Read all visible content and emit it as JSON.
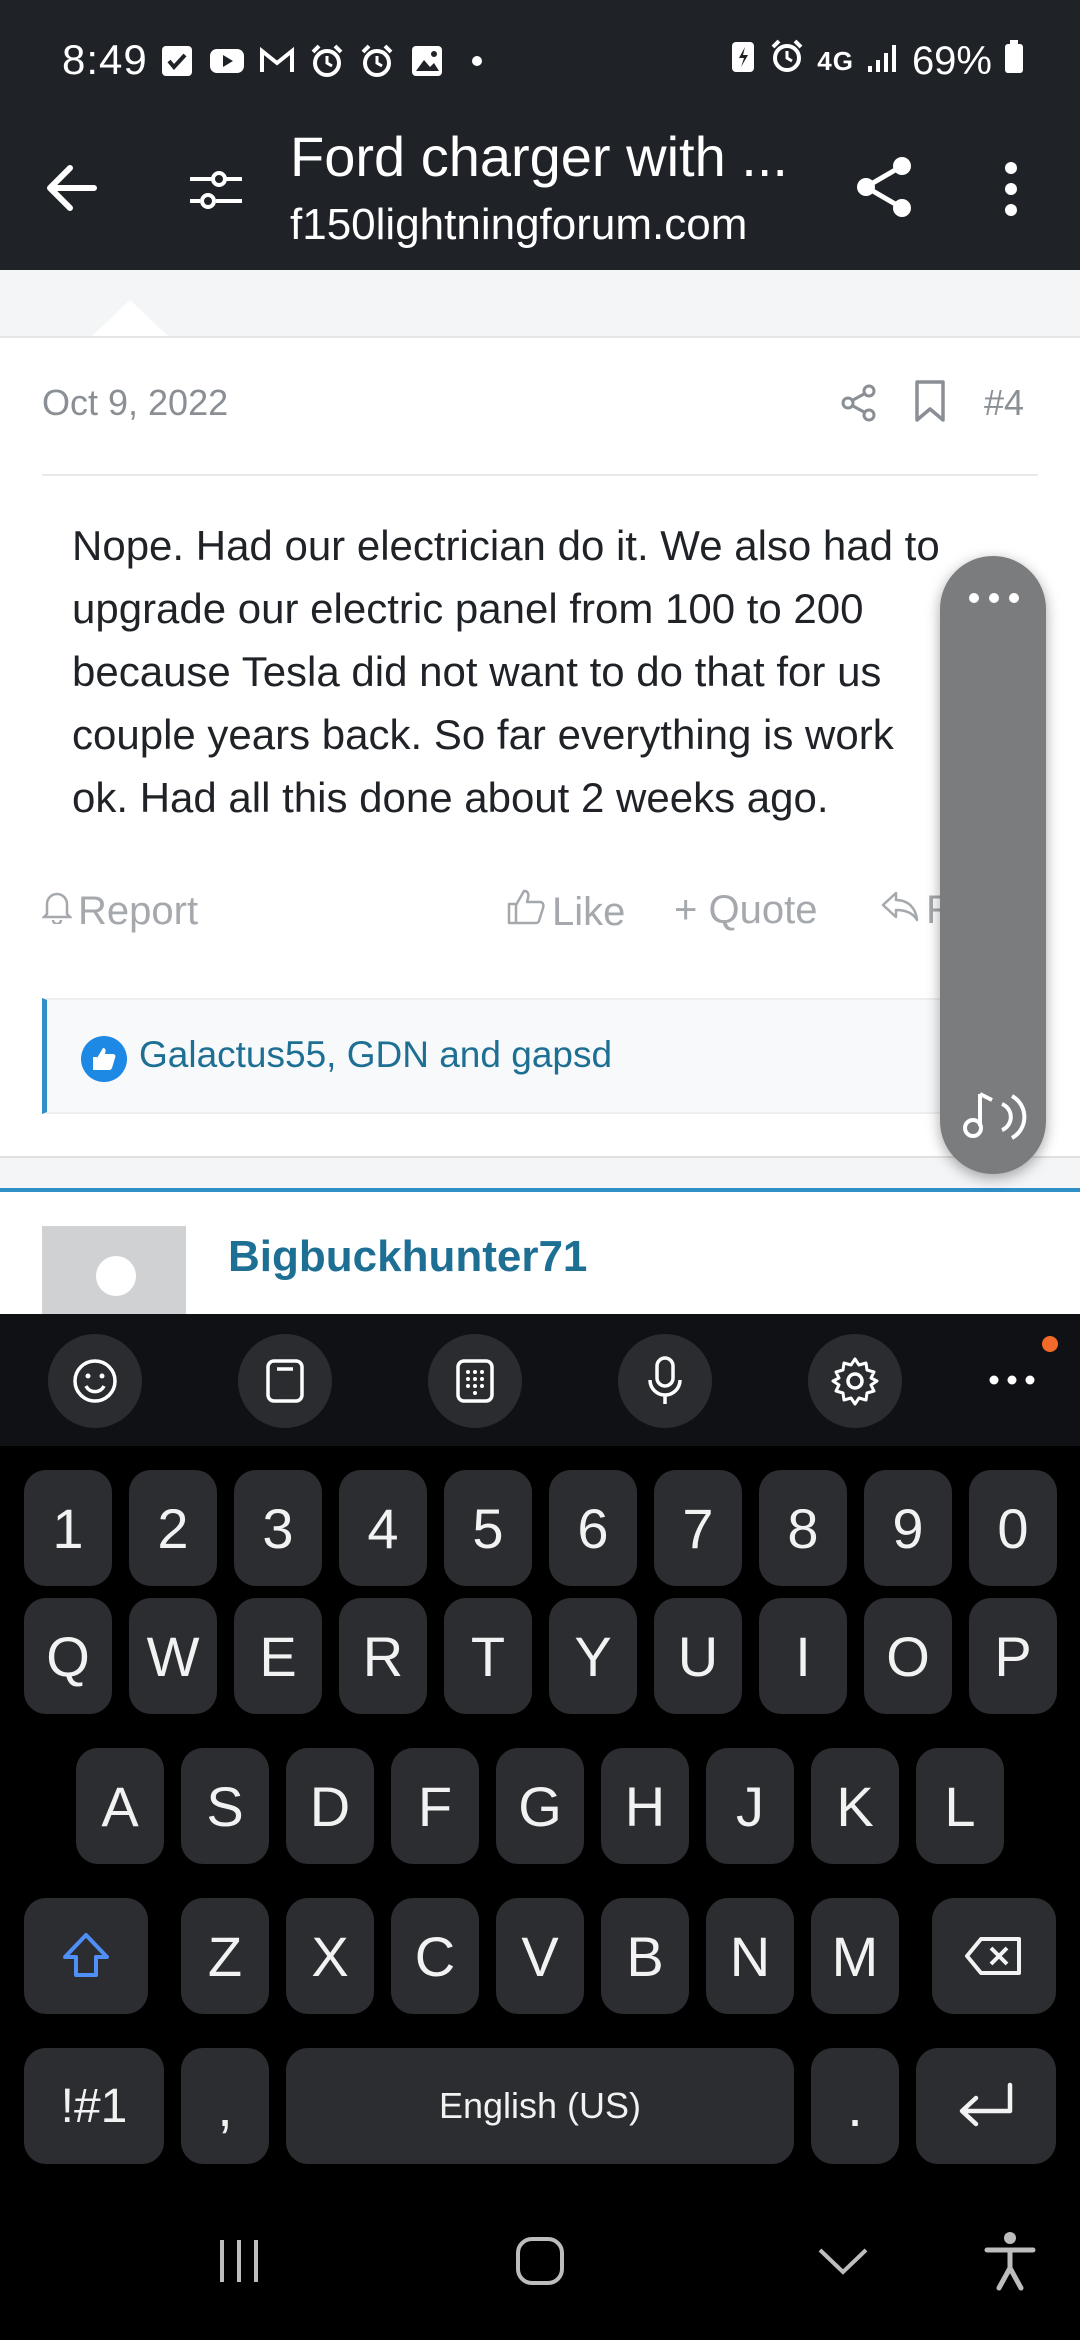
{
  "status_bar": {
    "time": "8:49",
    "network": "4G",
    "battery": "69%",
    "notification_icons": [
      "call-filter-icon",
      "youtube-icon",
      "gmail-icon",
      "alarm-icon",
      "alarm-icon",
      "gallery-icon",
      "dot-icon"
    ]
  },
  "app_bar": {
    "title": "Ford charger with ...",
    "url": "f150lightningforum.com"
  },
  "post": {
    "date": "Oct 9, 2022",
    "number": "#4",
    "body_lines": [
      "Nope. Had our electrician do it. We also had to",
      "upgrade our electric panel from 100 to 200",
      "because Tesla did not want to do that for us",
      "couple years back. So far everything is work",
      "ok. Had all this done about 2 weeks ago."
    ],
    "actions": {
      "report": "Report",
      "like": "Like",
      "quote": "+ Quote",
      "reply": "R"
    },
    "reactions_text": "Galactus55, GDN and gapsd"
  },
  "next_post": {
    "username": "Bigbuckhunter71"
  },
  "keyboard": {
    "toolbar": [
      "emoji-icon",
      "clipboard-icon",
      "keypad-icon",
      "microphone-icon",
      "settings-icon",
      "more-icon"
    ],
    "number_row": [
      "1",
      "2",
      "3",
      "4",
      "5",
      "6",
      "7",
      "8",
      "9",
      "0"
    ],
    "row1": [
      "Q",
      "W",
      "E",
      "R",
      "T",
      "Y",
      "U",
      "I",
      "O",
      "P"
    ],
    "row2": [
      "A",
      "S",
      "D",
      "F",
      "G",
      "H",
      "J",
      "K",
      "L"
    ],
    "row3": [
      "Z",
      "X",
      "C",
      "V",
      "B",
      "N",
      "M"
    ],
    "symbols": "!#1",
    "comma": ",",
    "space": "English (US)",
    "period": "."
  },
  "colors": {
    "appbar": "#1f2226",
    "link": "#1e6f94",
    "accent": "#2f8fc6",
    "shift": "#4f8ff7"
  }
}
